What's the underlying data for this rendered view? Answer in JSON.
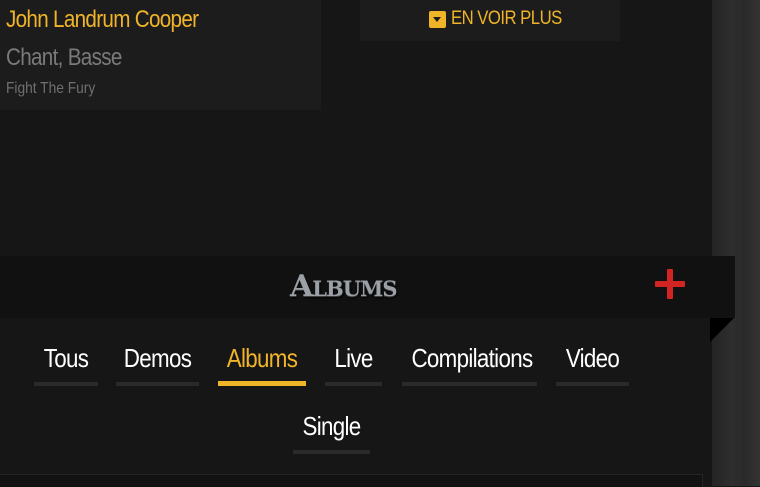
{
  "member": {
    "name": "John Landrum Cooper",
    "role": "Chant, Basse",
    "band": "Fight The Fury"
  },
  "more_button": {
    "label": "EN VOIR PLUS",
    "icon": "caret-square-down-icon"
  },
  "albums_section": {
    "title": "Albums",
    "add_icon": "plus-icon",
    "add_color": "#d32424"
  },
  "filter_tabs": [
    {
      "label": "Tous",
      "active": false
    },
    {
      "label": "Demos",
      "active": false
    },
    {
      "label": "Albums",
      "active": true
    },
    {
      "label": "Live",
      "active": false
    },
    {
      "label": "Compilations",
      "active": false
    },
    {
      "label": "Video",
      "active": false
    },
    {
      "label": "Single",
      "active": false
    }
  ],
  "colors": {
    "accent": "#f0b429",
    "background": "#161616",
    "text": "#ffffff"
  }
}
